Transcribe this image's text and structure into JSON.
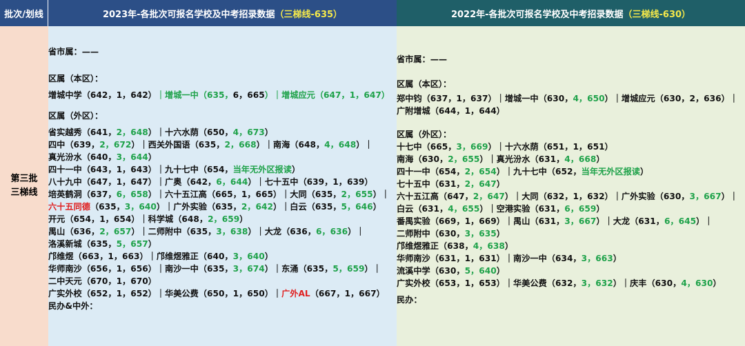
{
  "header": {
    "batch_label": "批次/划线",
    "col2023_prefix": "2023年-各批次可报名学校及中考招录数据",
    "col2023_highlight": "（三梯线-635）",
    "col2022_prefix": "2022年-各批次可报名学校及中考招录数据",
    "col2022_highlight": "（三梯线-630）"
  },
  "batch": {
    "line1": "第三批",
    "line2": "三梯线"
  },
  "col2023": {
    "provincial": "省市属：——",
    "district_in": "区属（本区）：",
    "district_in_line": "增城中学（642，1，642）｜增城一中（635，6，665）｜增城应元（647，1，647）",
    "district_out": "区属（外区）：",
    "private": "民办&中外："
  },
  "col2022": {
    "provincial": "省市属：——",
    "district_in": "区属（本区）：",
    "district_out": "区属（外区）：",
    "private": "民办："
  },
  "colors": {
    "header_2023": "#2c4f87",
    "header_2022": "#1f5f68",
    "batch_bg": "#f8dccc",
    "bg_2023": "#dcebf5",
    "bg_2022": "#e9f0dc",
    "green": "#1fa24a",
    "red": "#e02020",
    "highlight": "#f5e94a"
  },
  "tokens2023": [
    [
      "增城中学（642，1，642）",
      "｜增城一中（635，",
      "6，665",
      "）｜增城应元（647，1，647）"
    ],
    [
      "省实越秀（641，",
      "2，648",
      "）｜十六水荫（650，",
      "4，673",
      "）"
    ],
    [
      "四中（639，",
      "2，672",
      "）｜西关外国语（635，",
      "2，668",
      "）｜南海（648，",
      "4，648",
      "）｜"
    ],
    [
      "真光汾水（640，",
      "3，644",
      "）"
    ],
    [
      "四十一中（643，1，643）｜九十七中（654，",
      "当年无外区报读",
      "）"
    ],
    [
      "八十九中（647，1，647）｜广奥（642，",
      "6，644",
      "）｜七十五中（639，1，639）"
    ],
    [
      "培英鹤洞（637，",
      "6，658",
      "）｜六十五江高（665，1，665）｜大同（635，",
      "2，655",
      "）｜"
    ],
    [
      "六十五同德",
      "（635，",
      "3，640",
      "）｜广外实验（635，",
      "2，642",
      "）｜白云（635，",
      "5，646",
      "）"
    ],
    [
      "开元（654，1，654）｜科学城（648，",
      "2，659",
      "）"
    ],
    [
      "禺山（636，",
      "2，657",
      "）｜二师附中（635，",
      "3，638",
      "）｜大龙（636，",
      "6，636",
      "）｜"
    ],
    [
      "洛溪新城（635，",
      "5，657",
      "）"
    ],
    [
      "邝维煜（663，1，663）｜邝维煜雅正（640，",
      "3，640",
      "）"
    ],
    [
      "华师南沙（656，1，656）｜南沙一中（635，",
      "3，674",
      "）｜东涌（635，",
      "5，659",
      "）｜"
    ],
    [
      "二中天元（670，1，670）"
    ],
    [
      "广实外校（652，1，652）｜华美公费（650，1，650）｜",
      "广外AL",
      "（667，1，667）"
    ]
  ],
  "tokens2022": [
    [
      "郑中钧（637，1，637）｜增城一中（630，",
      "4，650",
      "）｜增城应元（630，2，636）｜"
    ],
    [
      "广附增城（644，1，644）"
    ],
    [
      "十七中（665，",
      "3，669",
      "）｜十六水荫（651，1，651）"
    ],
    [
      "南海（630，",
      "2，655",
      "）｜真光汾水（631，",
      "4，668",
      "）"
    ],
    [
      "四十一中（654，",
      "2，654",
      "）｜九十七中（652，",
      "当年无外区报读",
      "）"
    ],
    [
      "七十五中（631，",
      "2，647",
      "）"
    ],
    [
      "六十五江高（647，",
      "2，647",
      "）｜大同（632，1，632）｜广外实验（630，",
      "3，667",
      "）｜"
    ],
    [
      "白云（631，",
      "4，655",
      "）｜空港实验（631，",
      "6，659",
      "）"
    ],
    [
      "番禺实验（669，1，669）｜禺山（631，",
      "3，667",
      "）｜大龙（631，",
      "6，645",
      "）｜"
    ],
    [
      "二师附中（630，",
      "3，635",
      "）"
    ],
    [
      "邝维煜雅正（638，",
      "4，638",
      "）"
    ],
    [
      "华师南沙（631，1，631）｜南沙一中（634，",
      "3，663",
      "）"
    ],
    [
      "流溪中学（630，",
      "5，640",
      "）"
    ],
    [
      "广实外校（653，1，653）｜华美公费（632，",
      "3，632",
      "）｜庆丰（630，",
      "4，630",
      "）"
    ]
  ]
}
